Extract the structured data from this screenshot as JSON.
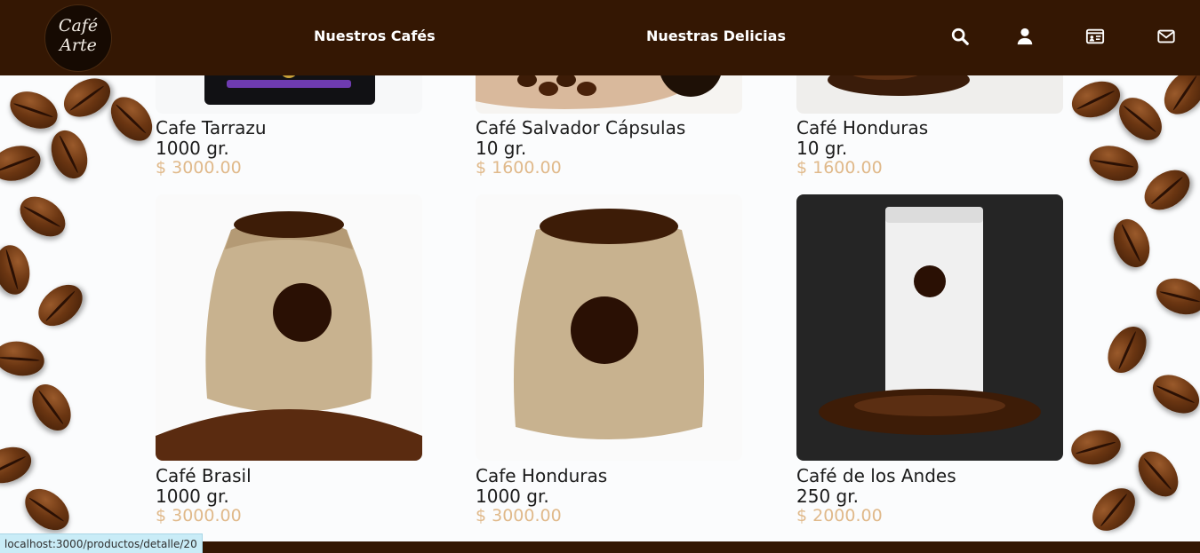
{
  "brand": {
    "logo_line1": "Café",
    "logo_line2": "Arte"
  },
  "nav": {
    "links": [
      "Nuestros Cafés",
      "Nuestras Delicias"
    ],
    "icons": [
      "search-icon",
      "user-icon",
      "id-card-icon",
      "envelope-icon"
    ]
  },
  "products": [
    {
      "name": "Cafe Tarrazu",
      "weight": "1000 gr.",
      "price": "$ 3000.00"
    },
    {
      "name": "Café Salvador Cápsulas",
      "weight": "10 gr.",
      "price": "$ 1600.00"
    },
    {
      "name": "Café Honduras",
      "weight": "10 gr.",
      "price": "$ 1600.00"
    },
    {
      "name": "Café Brasil",
      "weight": "1000 gr.",
      "price": "$ 3000.00",
      "image_label": "Café Brasil"
    },
    {
      "name": "Cafe Honduras",
      "weight": "1000 gr.",
      "price": "$ 3000.00",
      "image_label": "Café Honduras"
    },
    {
      "name": "Café de los Andes",
      "weight": "250 gr.",
      "price": "$ 2000.00",
      "image_label": "Café de Los Andes"
    }
  ],
  "status_bar": {
    "url": "localhost:3000/productos/detalle/20"
  },
  "colors": {
    "header_bg": "#341703",
    "nav_text": "#ffffff",
    "product_text": "#1b1b1b",
    "price": "#e0b98a",
    "status_bg": "#c9ecf7"
  }
}
